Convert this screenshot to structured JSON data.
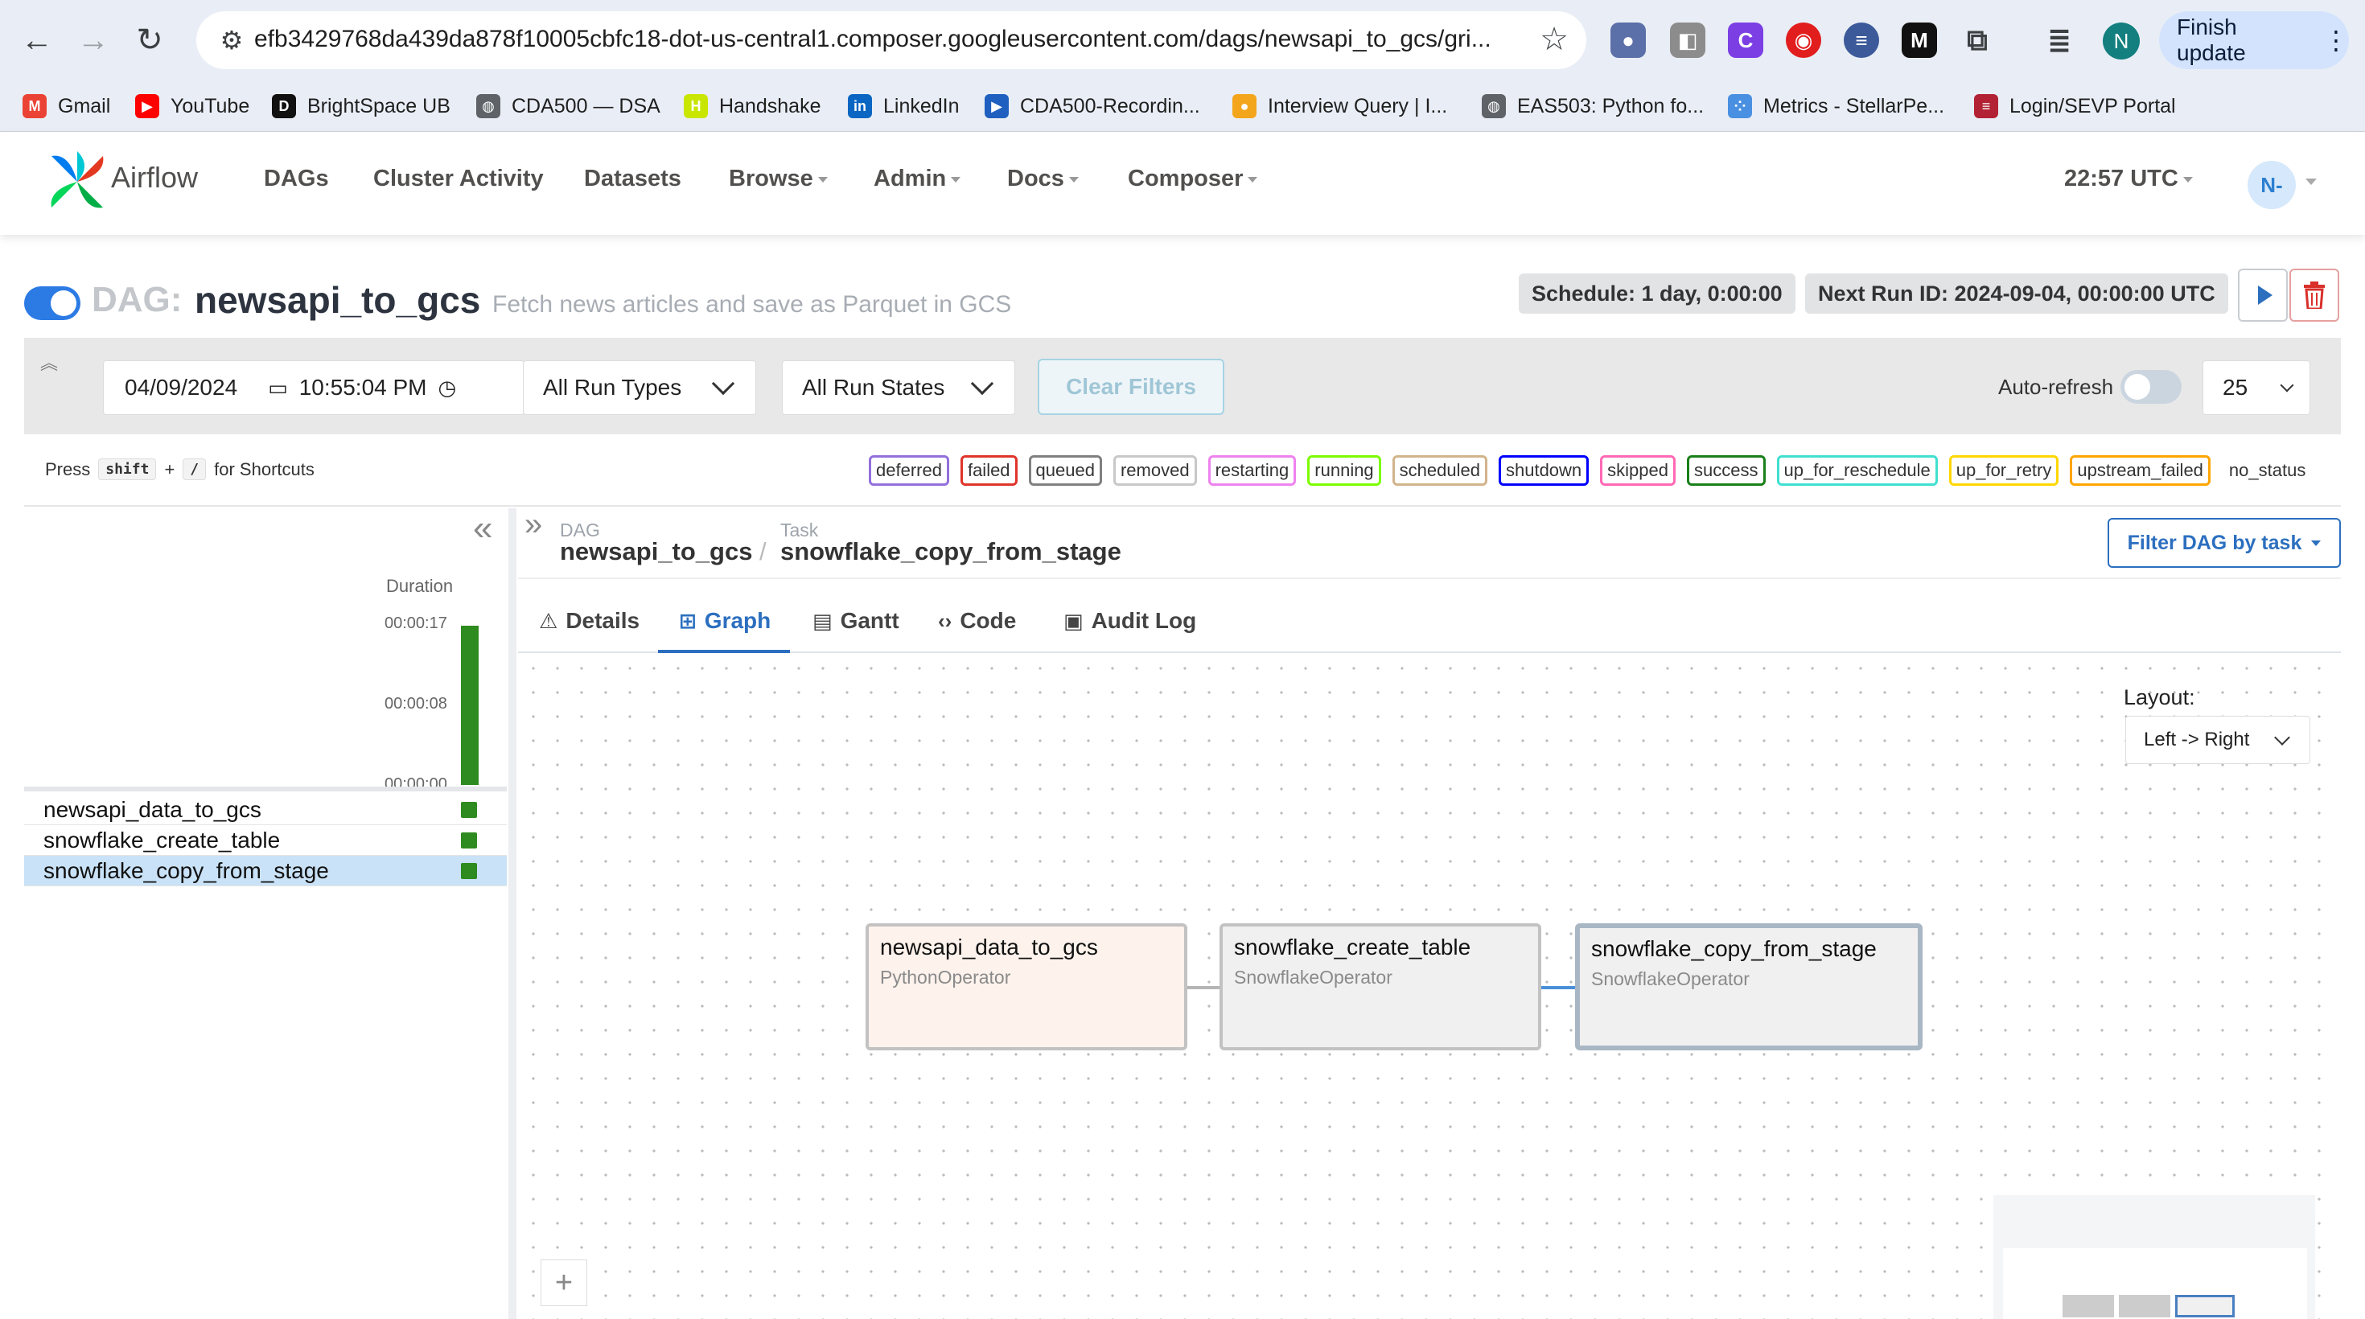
{
  "browser": {
    "url": "efb3429768da439da878f10005cbfc18-dot-us-central1.composer.googleusercontent.com/dags/newsapi_to_gcs/gri...",
    "profile_initial": "N",
    "finish_update": "Finish update",
    "bookmarks": [
      {
        "label": "Gmail",
        "icon": "gmail-icon",
        "color": "#ea4335",
        "glyph": "M"
      },
      {
        "label": "YouTube",
        "icon": "youtube-icon",
        "color": "#ff0000",
        "glyph": "▶"
      },
      {
        "label": "BrightSpace UB",
        "icon": "d2l-icon",
        "color": "#111111",
        "glyph": "D"
      },
      {
        "label": "CDA500 — DSA",
        "icon": "globe-icon",
        "color": "#5f6368",
        "glyph": "◍"
      },
      {
        "label": "Handshake",
        "icon": "handshake-icon",
        "color": "#c8e600",
        "glyph": "H"
      },
      {
        "label": "LinkedIn",
        "icon": "linkedin-icon",
        "color": "#0a66c2",
        "glyph": "in"
      },
      {
        "label": "CDA500-Recordin...",
        "icon": "panopto-icon",
        "color": "#1f5fbf",
        "glyph": "▶"
      },
      {
        "label": "Interview Query | I...",
        "icon": "interview-query-icon",
        "color": "#f3a51c",
        "glyph": "●"
      },
      {
        "label": "EAS503: Python fo...",
        "icon": "globe-icon",
        "color": "#5f6368",
        "glyph": "◍"
      },
      {
        "label": "Metrics - StellarPe...",
        "icon": "metrics-icon",
        "color": "#4a90e2",
        "glyph": "⁘"
      },
      {
        "label": "Login/SEVP Portal",
        "icon": "us-flag-icon",
        "color": "#b22234",
        "glyph": "≡"
      }
    ]
  },
  "airflow": {
    "logo_text": "Airflow",
    "menu": [
      {
        "label": "DAGs",
        "dropdown": false
      },
      {
        "label": "Cluster Activity",
        "dropdown": false
      },
      {
        "label": "Datasets",
        "dropdown": false
      },
      {
        "label": "Browse",
        "dropdown": true
      },
      {
        "label": "Admin",
        "dropdown": true
      },
      {
        "label": "Docs",
        "dropdown": true
      },
      {
        "label": "Composer",
        "dropdown": true
      }
    ],
    "time": "22:57 UTC",
    "user_initials": "N-"
  },
  "dag": {
    "label": "DAG:",
    "id": "newsapi_to_gcs",
    "description": "Fetch news articles and save as Parquet in GCS",
    "schedule": "Schedule: 1 day, 0:00:00",
    "next_run": "Next Run ID: 2024-09-04, 00:00:00 UTC",
    "paused": false
  },
  "filters": {
    "date": "04/09/2024",
    "time": "10:55:04 PM",
    "run_types": "All Run Types",
    "run_states": "All Run States",
    "clear": "Clear Filters",
    "auto_refresh_label": "Auto-refresh",
    "auto_refresh_on": false,
    "page_size": "25"
  },
  "shortcuts": {
    "press": "Press",
    "key1": "shift",
    "plus": "+",
    "key2": "/",
    "suffix": "for Shortcuts"
  },
  "legend": [
    {
      "label": "deferred",
      "color": "#9370db"
    },
    {
      "label": "failed",
      "color": "#e0342a"
    },
    {
      "label": "queued",
      "color": "#808080"
    },
    {
      "label": "removed",
      "color": "#c8c8c8"
    },
    {
      "label": "restarting",
      "color": "#ee82ee"
    },
    {
      "label": "running",
      "color": "#7cfc00"
    },
    {
      "label": "scheduled",
      "color": "#d2b48c"
    },
    {
      "label": "shutdown",
      "color": "#0000ff"
    },
    {
      "label": "skipped",
      "color": "#ff69b4"
    },
    {
      "label": "success",
      "color": "#1a7f1a"
    },
    {
      "label": "up_for_reschedule",
      "color": "#40e0d0"
    },
    {
      "label": "up_for_retry",
      "color": "#ffd700"
    },
    {
      "label": "upstream_failed",
      "color": "#ffa500"
    },
    {
      "label": "no_status",
      "color": ""
    }
  ],
  "grid": {
    "duration_label": "Duration",
    "ticks": [
      "00:00:17",
      "00:00:08",
      "00:00:00"
    ],
    "tasks": [
      {
        "name": "newsapi_data_to_gcs",
        "state": "success",
        "selected": false
      },
      {
        "name": "snowflake_create_table",
        "state": "success",
        "selected": false
      },
      {
        "name": "snowflake_copy_from_stage",
        "state": "success",
        "selected": true
      }
    ]
  },
  "breadcrumb": {
    "dag_label": "DAG",
    "dag_value": "newsapi_to_gcs",
    "sep": "/",
    "task_label": "Task",
    "task_value": "snowflake_copy_from_stage"
  },
  "filter_dag_btn": "Filter DAG by task",
  "tabs": [
    {
      "label": "Details",
      "icon": "warning-triangle-icon",
      "glyph": "⚠",
      "active": false
    },
    {
      "label": "Graph",
      "icon": "graph-icon",
      "glyph": "⊞",
      "active": true
    },
    {
      "label": "Gantt",
      "icon": "gantt-icon",
      "glyph": "▤",
      "active": false
    },
    {
      "label": "Code",
      "icon": "code-icon",
      "glyph": "‹›",
      "active": false
    },
    {
      "label": "Audit Log",
      "icon": "audit-log-icon",
      "glyph": "▣",
      "active": false
    }
  ],
  "graph": {
    "layout_label": "Layout:",
    "layout_value": "Left -> Right",
    "nodes": [
      {
        "name": "newsapi_data_to_gcs",
        "operator": "PythonOperator",
        "bg": "#fdf2ec",
        "selected": false
      },
      {
        "name": "snowflake_create_table",
        "operator": "SnowflakeOperator",
        "bg": "#f0f0f0",
        "selected": false
      },
      {
        "name": "snowflake_copy_from_stage",
        "operator": "SnowflakeOperator",
        "bg": "#f0f0f0",
        "selected": true
      }
    ]
  }
}
